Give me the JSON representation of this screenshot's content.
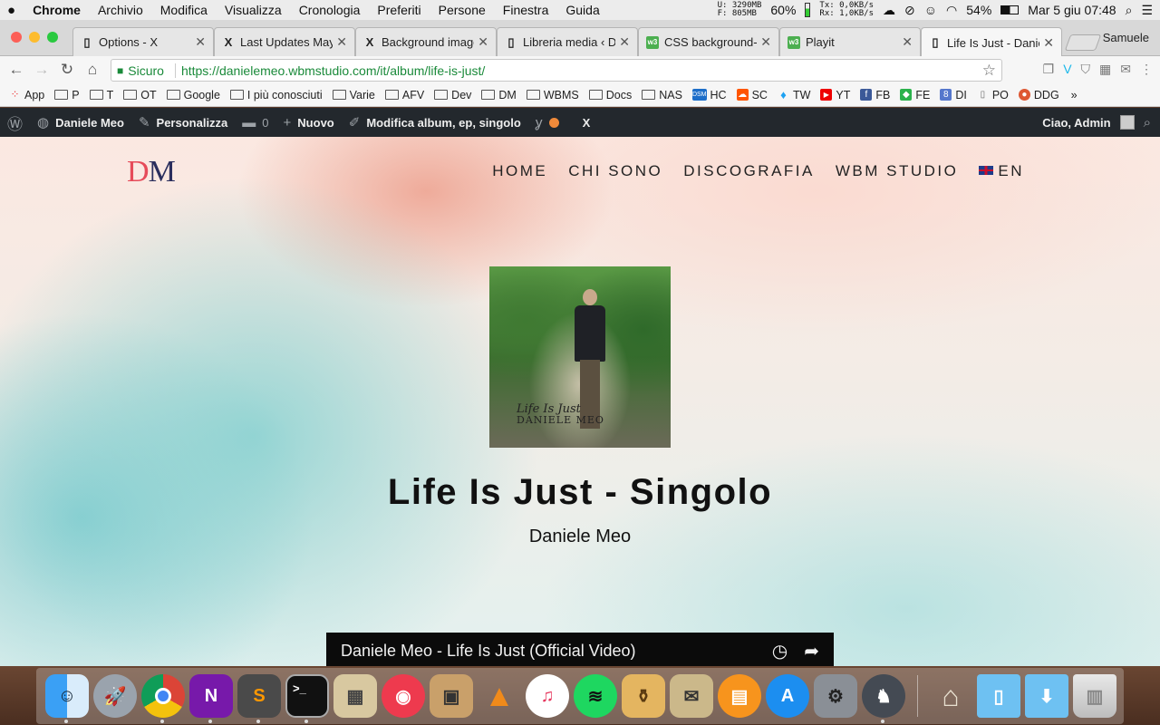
{
  "menubar": {
    "apple": "",
    "app": "Chrome",
    "items": [
      "Archivio",
      "Modifica",
      "Visualizza",
      "Cronologia",
      "Preferiti",
      "Persone",
      "Finestra",
      "Guida"
    ],
    "mem_u": "U: 3290MB",
    "mem_f": "F:  805MB",
    "cpu": "60%",
    "net_tx": "Tx:   0,0KB/s",
    "net_rx": "Rx:   1,0KB/s",
    "battery": "54%",
    "clock": "Mar 5 giu  07:48"
  },
  "tabs": [
    {
      "title": "Options - X",
      "icon": "page-icon"
    },
    {
      "title": "Last Updates May",
      "icon": "x-logo-icon"
    },
    {
      "title": "Background image",
      "icon": "x-logo-icon"
    },
    {
      "title": "Libreria media ‹ D",
      "icon": "page-icon"
    },
    {
      "title": "CSS background-",
      "icon": "w3-icon"
    },
    {
      "title": "Playit",
      "icon": "w3-icon"
    },
    {
      "title": "Life Is Just - Danie",
      "icon": "page-icon",
      "active": true
    }
  ],
  "profile": "Samuele",
  "address": {
    "secure_label": "Sicuro",
    "url": "https://danielemeo.wbmstudio.com/it/album/life-is-just/"
  },
  "bookmarks": [
    "App",
    "P",
    "T",
    "OT",
    "Google",
    "I più conosciuti",
    "Varie",
    "AFV",
    "Dev",
    "DM",
    "WBMS",
    "Docs",
    "NAS",
    "HC",
    "SC",
    "TW",
    "YT",
    "FB",
    "FE",
    "DI",
    "PO",
    "DDG"
  ],
  "wp_admin": {
    "site": "Daniele Meo",
    "customize": "Personalizza",
    "comments": "0",
    "new": "Nuovo",
    "edit": "Modifica album, ep, singolo",
    "x": "X",
    "greeting": "Ciao, Admin"
  },
  "site": {
    "logo_d": "D",
    "logo_m": "M",
    "nav": [
      "HOME",
      "CHI SONO",
      "DISCOGRAFIA",
      "WBM STUDIO",
      "EN"
    ],
    "cover_text_1": "Life Is Just",
    "cover_text_2": "DANIELE MEO",
    "title": "Life Is Just - Singolo",
    "artist": "Daniele Meo",
    "video_title": "Daniele Meo - Life Is Just (Official Video)"
  },
  "dock": [
    "Finder",
    "Launchpad",
    "Chrome",
    "OneNote",
    "Sublime Text",
    "Terminal",
    "Calculator",
    "Speedtest",
    "Archive Utility",
    "VLC",
    "iTunes",
    "Spotify",
    "Potion",
    "Preview",
    "iBooks",
    "App Store",
    "System Preferences",
    "TablePlus",
    "Home",
    "Applications",
    "Downloads",
    "Trash"
  ]
}
